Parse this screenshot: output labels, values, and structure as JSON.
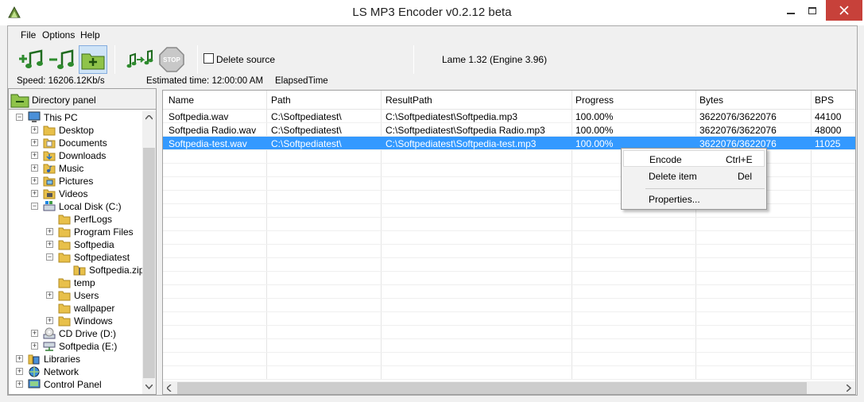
{
  "window": {
    "title": "LS MP3 Encoder v0.2.12 beta"
  },
  "menu": {
    "file": "File",
    "options": "Options",
    "help": "Help"
  },
  "toolbar": {
    "delete_source": "Delete source",
    "lame": "Lame 1.32 (Engine 3.96)",
    "stop_label": "STOP"
  },
  "status": {
    "speed": "Speed: 16206.12Kb/s",
    "estimated": "Estimated time: 12:00:00 AM",
    "elapsed": "ElapsedTime"
  },
  "directory_panel": {
    "title": "Directory panel",
    "tree": [
      {
        "label": "This PC",
        "icon": "computer-icon",
        "expander": "−"
      },
      {
        "label": "Desktop",
        "icon": "folder-icon",
        "expander": "+"
      },
      {
        "label": "Documents",
        "icon": "documents-folder-icon",
        "expander": "+"
      },
      {
        "label": "Downloads",
        "icon": "downloads-folder-icon",
        "expander": "+"
      },
      {
        "label": "Music",
        "icon": "music-folder-icon",
        "expander": "+"
      },
      {
        "label": "Pictures",
        "icon": "pictures-folder-icon",
        "expander": "+"
      },
      {
        "label": "Videos",
        "icon": "videos-folder-icon",
        "expander": "+"
      },
      {
        "label": "Local Disk (C:)",
        "icon": "drive-icon",
        "expander": "−"
      },
      {
        "label": "PerfLogs",
        "icon": "folder-icon",
        "expander": ""
      },
      {
        "label": "Program Files",
        "icon": "folder-icon",
        "expander": "+"
      },
      {
        "label": "Softpedia",
        "icon": "folder-icon",
        "expander": "+"
      },
      {
        "label": "Softpediatest",
        "icon": "folder-icon",
        "expander": "−"
      },
      {
        "label": "Softpedia.zip",
        "icon": "zip-folder-icon",
        "expander": ""
      },
      {
        "label": "temp",
        "icon": "folder-icon",
        "expander": ""
      },
      {
        "label": "Users",
        "icon": "folder-icon",
        "expander": "+"
      },
      {
        "label": "wallpaper",
        "icon": "folder-icon",
        "expander": ""
      },
      {
        "label": "Windows",
        "icon": "folder-icon",
        "expander": "+"
      },
      {
        "label": "CD Drive (D:)",
        "icon": "cd-drive-icon",
        "expander": "+"
      },
      {
        "label": "Softpedia (E:)",
        "icon": "network-drive-icon",
        "expander": "+"
      },
      {
        "label": "Libraries",
        "icon": "libraries-icon",
        "expander": "+"
      },
      {
        "label": "Network",
        "icon": "network-icon",
        "expander": "+"
      },
      {
        "label": "Control Panel",
        "icon": "control-panel-icon",
        "expander": "+"
      }
    ]
  },
  "list": {
    "columns": [
      "Name",
      "Path",
      "ResultPath",
      "Progress",
      "Bytes",
      "BPS"
    ],
    "rows": [
      [
        "Softpedia.wav",
        "C:\\Softpediatest\\",
        "C:\\Softpediatest\\Softpedia.mp3",
        "100.00%",
        "3622076/3622076",
        "44100"
      ],
      [
        "Softpedia Radio.wav",
        "C:\\Softpediatest\\",
        "C:\\Softpediatest\\Softpedia Radio.mp3",
        "100.00%",
        "3622076/3622076",
        "48000"
      ],
      [
        "Softpedia-test.wav",
        "C:\\Softpediatest\\",
        "C:\\Softpediatest\\Softpedia-test.mp3",
        "100.00%",
        "3622076/3622076",
        "11025"
      ]
    ]
  },
  "context_menu": {
    "encode": "Encode",
    "encode_shortcut": "Ctrl+E",
    "delete": "Delete item",
    "delete_shortcut": "Del",
    "properties": "Properties..."
  },
  "colors": {
    "selection": "#3399ff",
    "close": "#c7413a",
    "note_green": "#2e8b2e",
    "folder": "#e8c04a"
  }
}
